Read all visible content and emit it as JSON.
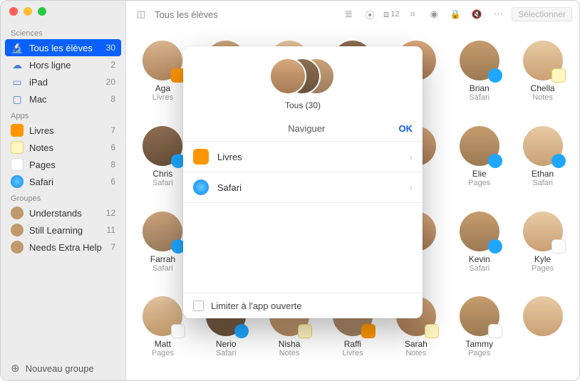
{
  "topbar": {
    "title": "Tous les élèves",
    "inbox_count": "12",
    "select_label": "Sélectionner"
  },
  "sidebar": {
    "sections": {
      "sciences": "Sciences",
      "apps": "Apps",
      "groupes": "Groupes"
    },
    "sciences": [
      {
        "icon": "microscope",
        "label": "Tous les élèves",
        "count": "30",
        "selected": true
      },
      {
        "icon": "offline",
        "label": "Hors ligne",
        "count": "2"
      },
      {
        "icon": "ipad",
        "label": "iPad",
        "count": "20"
      },
      {
        "icon": "mac",
        "label": "Mac",
        "count": "8"
      }
    ],
    "apps": [
      {
        "icon": "livres",
        "label": "Livres",
        "count": "7"
      },
      {
        "icon": "notes",
        "label": "Notes",
        "count": "6"
      },
      {
        "icon": "pages",
        "label": "Pages",
        "count": "8"
      },
      {
        "icon": "safari",
        "label": "Safari",
        "count": "6"
      }
    ],
    "groupes": [
      {
        "icon": "group",
        "label": "Understands",
        "count": "12"
      },
      {
        "icon": "group",
        "label": "Still Learning",
        "count": "11"
      },
      {
        "icon": "group",
        "label": "Needs Extra Help",
        "count": "7"
      }
    ],
    "footer": "Nouveau groupe"
  },
  "students": [
    {
      "name": "Aga",
      "app": "Livres",
      "badge": "livres",
      "tint": "t0"
    },
    {
      "name": "",
      "app": "",
      "badge": "",
      "tint": "t1"
    },
    {
      "name": "",
      "app": "",
      "badge": "",
      "tint": "t2"
    },
    {
      "name": "",
      "app": "",
      "badge": "",
      "tint": "t3"
    },
    {
      "name": "",
      "app": "",
      "badge": "",
      "tint": "t4"
    },
    {
      "name": "Brian",
      "app": "Safari",
      "badge": "safari",
      "tint": "t5"
    },
    {
      "name": "Chella",
      "app": "Notes",
      "badge": "notes",
      "tint": "t6"
    },
    {
      "name": "Chris",
      "app": "Safari",
      "badge": "safari",
      "tint": "t3"
    },
    {
      "name": "",
      "app": "",
      "badge": "",
      "tint": "t0"
    },
    {
      "name": "",
      "app": "",
      "badge": "",
      "tint": "t1"
    },
    {
      "name": "",
      "app": "",
      "badge": "",
      "tint": "t2"
    },
    {
      "name": "",
      "app": "",
      "badge": "",
      "tint": "t4"
    },
    {
      "name": "Elie",
      "app": "Pages",
      "badge": "safari",
      "tint": "t5"
    },
    {
      "name": "Ethan",
      "app": "Safari",
      "badge": "safari",
      "tint": "t6"
    },
    {
      "name": "Farrah",
      "app": "Safari",
      "badge": "safari",
      "tint": "t1"
    },
    {
      "name": "",
      "app": "",
      "badge": "",
      "tint": "t2"
    },
    {
      "name": "",
      "app": "",
      "badge": "",
      "tint": "t3"
    },
    {
      "name": "",
      "app": "",
      "badge": "",
      "tint": "t0"
    },
    {
      "name": "",
      "app": "",
      "badge": "",
      "tint": "t4"
    },
    {
      "name": "Kevin",
      "app": "Safari",
      "badge": "safari",
      "tint": "t5"
    },
    {
      "name": "Kyle",
      "app": "Pages",
      "badge": "pages",
      "tint": "t6"
    },
    {
      "name": "Matt",
      "app": "Pages",
      "badge": "pages",
      "tint": "t2"
    },
    {
      "name": "Nerio",
      "app": "Safari",
      "badge": "safari",
      "tint": "t3"
    },
    {
      "name": "Nisha",
      "app": "Notes",
      "badge": "notes",
      "tint": "t0"
    },
    {
      "name": "Raffi",
      "app": "Livres",
      "badge": "livres",
      "tint": "t1"
    },
    {
      "name": "Sarah",
      "app": "Notes",
      "badge": "notes",
      "tint": "t4"
    },
    {
      "name": "Tammy",
      "app": "Pages",
      "badge": "pages",
      "tint": "t5"
    },
    {
      "name": "",
      "app": "",
      "badge": "",
      "tint": "t6"
    }
  ],
  "modal": {
    "count_label": "Tous (30)",
    "title": "Naviguer",
    "ok": "OK",
    "rows": [
      {
        "icon": "livres",
        "label": "Livres"
      },
      {
        "icon": "safari",
        "label": "Safari"
      }
    ],
    "footer_label": "Limiter à l'app ouverte"
  }
}
